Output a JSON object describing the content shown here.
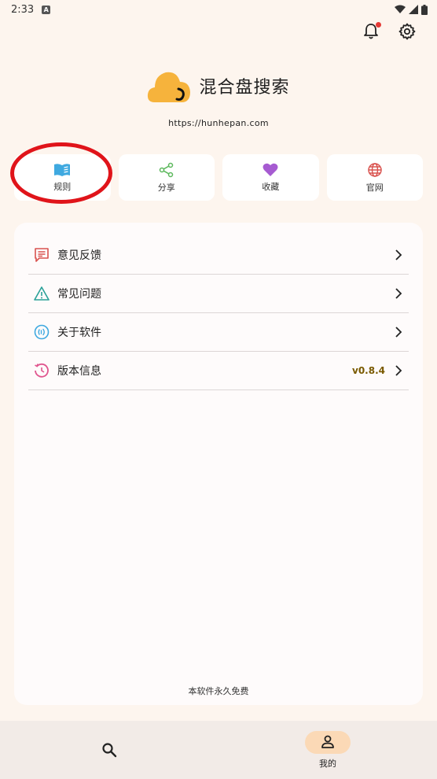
{
  "status_bar": {
    "time": "2:33",
    "app_icon_letter": "A"
  },
  "brand": {
    "title": "混合盘搜索",
    "url": "https://hunhepan.com"
  },
  "quick_actions": [
    {
      "label": "规则",
      "icon": "book-icon",
      "color": "#3fa9e0"
    },
    {
      "label": "分享",
      "icon": "share-icon",
      "color": "#5cb85c"
    },
    {
      "label": "收藏",
      "icon": "heart-icon",
      "color": "#a65bd1"
    },
    {
      "label": "官网",
      "icon": "globe-icon",
      "color": "#d9534f"
    }
  ],
  "menu": [
    {
      "label": "意见反馈",
      "icon": "feedback-icon",
      "color": "#d9534f"
    },
    {
      "label": "常见问题",
      "icon": "warning-icon",
      "color": "#2aa198"
    },
    {
      "label": "关于软件",
      "icon": "info-circle-icon",
      "color": "#3fa9e0"
    },
    {
      "label": "版本信息",
      "icon": "history-icon",
      "color": "#e0568f",
      "value": "v0.8.4"
    }
  ],
  "footer_note": "本软件永久免费",
  "bottom_nav": [
    {
      "label": "",
      "icon": "search-icon",
      "active": false
    },
    {
      "label": "我的",
      "icon": "person-icon",
      "active": true
    }
  ],
  "colors": {
    "accent": "#f6b33c",
    "highlight": "#e0141a",
    "version_text": "#7a5a00"
  }
}
